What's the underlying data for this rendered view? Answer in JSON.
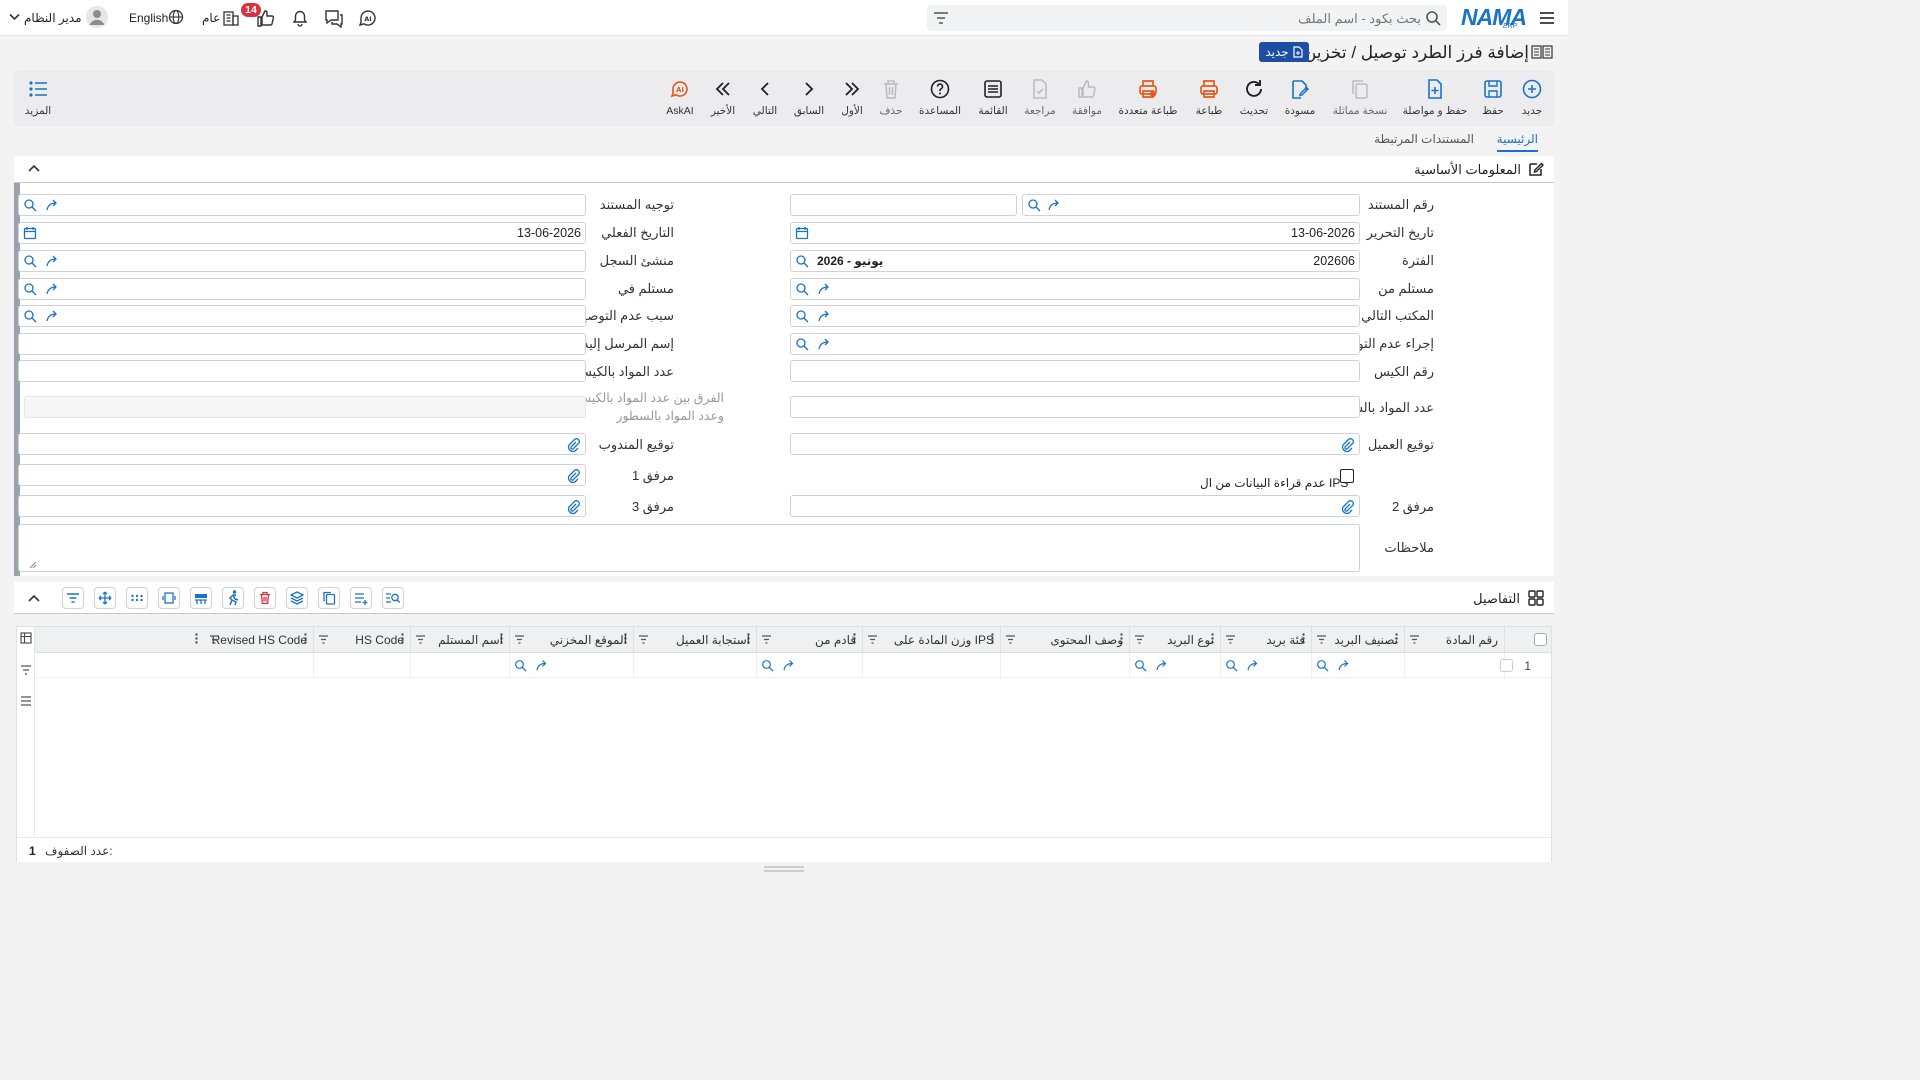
{
  "app": {
    "logo_text": "NAMA",
    "logo_sub": "ERP"
  },
  "search": {
    "placeholder": "بحث بكود - اسم الملف"
  },
  "user": {
    "name": "مدير النظام"
  },
  "language": {
    "label": "English"
  },
  "company": {
    "label": "عام"
  },
  "notifications": {
    "count": "14"
  },
  "page": {
    "title": "إضافة فرز الطرد توصيل / تخزين",
    "status_badge": "جديد"
  },
  "toolbar": {
    "items": [
      {
        "label": "جديد"
      },
      {
        "label": "حفظ"
      },
      {
        "label": "حفظ و مواصلة"
      },
      {
        "label": "نسخة مماثلة"
      },
      {
        "label": "مسودة"
      },
      {
        "label": "تحديث"
      },
      {
        "label": "طباعة"
      },
      {
        "label": "طباعة متعددة"
      },
      {
        "label": "موافقة"
      },
      {
        "label": "مراجعة"
      },
      {
        "label": "القائمة"
      },
      {
        "label": "المساعدة"
      },
      {
        "label": "حذف"
      },
      {
        "label": "الأول"
      },
      {
        "label": "السابق"
      },
      {
        "label": "التالي"
      },
      {
        "label": "الأخير"
      },
      {
        "label": "AskAI"
      }
    ],
    "more_label": "المزيد"
  },
  "tabs": [
    {
      "label": "الرئيسية"
    },
    {
      "label": "المستندات المرتبطة"
    }
  ],
  "section_basic": {
    "title": "المعلومات الأساسية"
  },
  "form": {
    "doc_number": {
      "label": "رقم المستند",
      "value": ""
    },
    "doc_direction": {
      "label": "توجيه المستند",
      "value": ""
    },
    "edit_date": {
      "label": "تاريخ التحرير",
      "value": "13-06-2026"
    },
    "actual_date": {
      "label": "التاريخ الفعلي",
      "value": "13-06-2026"
    },
    "period": {
      "label": "الفترة",
      "value": "202606",
      "value_name": "2026 - يونيو"
    },
    "record_origin": {
      "label": "منشئ السجل",
      "value": ""
    },
    "received_from": {
      "label": "مستلم من",
      "value": ""
    },
    "received_at": {
      "label": "مستلم في",
      "value": ""
    },
    "next_office": {
      "label": "المكتب التالي",
      "value": ""
    },
    "non_delivery_reason": {
      "label": "سبب عدم التوصيل",
      "value": ""
    },
    "non_delivery_action": {
      "label": "إجراء عدم التوصيل",
      "value": ""
    },
    "addressee_name": {
      "label": "إسم المرسل إليه",
      "value": ""
    },
    "bag_number": {
      "label": "رقم الكيس",
      "value": ""
    },
    "bag_items_count": {
      "label": "عدد المواد بالكيس",
      "value": ""
    },
    "line_items_count": {
      "label": "عدد المواد بالسطور",
      "value": ""
    },
    "items_diff": {
      "label_line1": "الفرق بين عدد المواد بالكيس",
      "label_line2": "وعدد المواد بالسطور",
      "value": ""
    },
    "client_signature": {
      "label": "توقيع العميل"
    },
    "agent_signature": {
      "label": "توقيع المندوب"
    },
    "ips_checkbox": {
      "label": "عدم قراءة البيانات من ال IPS",
      "checked": false
    },
    "attachment1": {
      "label": "مرفق 1"
    },
    "attachment2": {
      "label": "مرفق 2"
    },
    "attachment3": {
      "label": "مرفق 3"
    },
    "notes": {
      "label": "ملاحظات",
      "value": ""
    }
  },
  "section_details": {
    "title": "التفاصيل"
  },
  "grid": {
    "columns": [
      {
        "label": "رقم المادة"
      },
      {
        "label": "تصنيف البريد"
      },
      {
        "label": "فئة بريد"
      },
      {
        "label": "نوع البريد"
      },
      {
        "label": "وصف المحتوى"
      },
      {
        "label": "وزن المادة على IPS"
      },
      {
        "label": "قادم من"
      },
      {
        "label": "استجابة العميل"
      },
      {
        "label": "الموقع المخزني"
      },
      {
        "label": "اسم المستلم"
      },
      {
        "label": "HS Code"
      },
      {
        "label": "Revised HS Code"
      }
    ],
    "rows": [
      {
        "index": "1"
      }
    ],
    "footer_label": "عدد الصفوف:",
    "footer_count": "1"
  },
  "colors": {
    "accent": "#1a73c8",
    "danger": "#d9333f",
    "orange": "#e8581c",
    "badge": "#1d4ea3"
  }
}
